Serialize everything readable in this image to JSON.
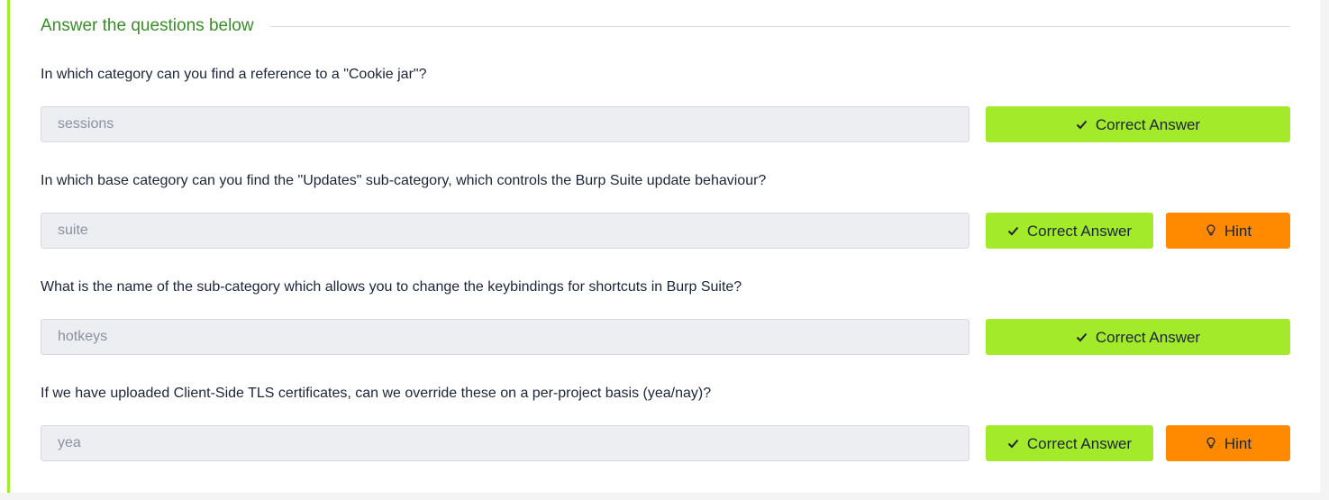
{
  "section": {
    "title": "Answer the questions below"
  },
  "questions": [
    {
      "text": "In which category can you find a reference to a \"Cookie jar\"?",
      "answer": "sessions",
      "correct_label": "Correct Answer",
      "has_hint": false
    },
    {
      "text": "In which base category can you find the \"Updates\" sub-category, which controls the Burp Suite update behaviour?",
      "answer": "suite",
      "correct_label": "Correct Answer",
      "has_hint": true,
      "hint_label": "Hint"
    },
    {
      "text": "What is the name of the sub-category which allows you to change the keybindings for shortcuts in Burp Suite?",
      "answer": "hotkeys",
      "correct_label": "Correct Answer",
      "has_hint": false
    },
    {
      "text": "If we have uploaded Client-Side TLS certificates, can we override these on a per-project basis (yea/nay)?",
      "answer": "yea",
      "correct_label": "Correct Answer",
      "has_hint": true,
      "hint_label": "Hint"
    }
  ],
  "icons": {
    "correct": "check-icon",
    "hint": "lightbulb-icon"
  },
  "colors": {
    "accent": "#a3ea2a",
    "title": "#3b8c2a",
    "hint": "#ff8a00",
    "input_bg": "#eceef2",
    "text": "#1c2538"
  }
}
